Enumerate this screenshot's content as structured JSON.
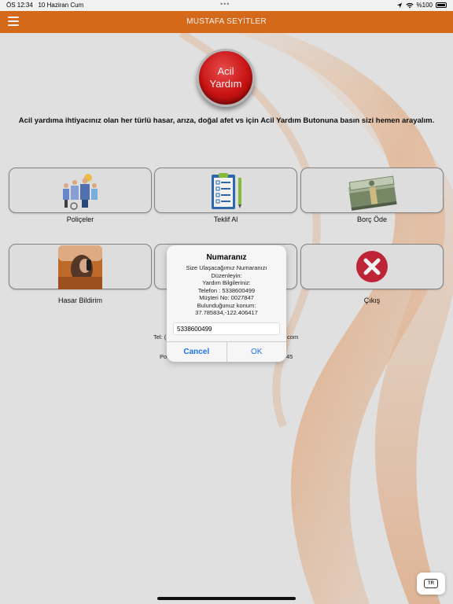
{
  "status_bar": {
    "time": "ÖS 12:34",
    "date": "10 Haziran Cum",
    "battery": "%100"
  },
  "header": {
    "title": "MUSTAFA SEYİTLER"
  },
  "emergency": {
    "button_label_line1": "Acil",
    "button_label_line2": "Yardım",
    "description": "Acil yardıma ihtiyacınız olan her türlü hasar, arıza, doğal afet vs için Acil Yardım Butonuna basın sizi hemen arayalım."
  },
  "tiles": [
    {
      "label": "Poliçeler",
      "icon": "family-icon"
    },
    {
      "label": "Teklif Al",
      "icon": "clipboard-icon"
    },
    {
      "label": "Borç Öde",
      "icon": "money-icon"
    },
    {
      "label": "Hasar Bildirim",
      "icon": "phone-call-icon"
    },
    {
      "label": "",
      "icon": "hidden-tile-icon"
    },
    {
      "label": "Çıkış",
      "icon": "exit-icon"
    }
  ],
  "contact": {
    "tel_prefix": "Tel: (",
    "tel_suffix": "com",
    "posta_prefix": "Po",
    "posta_suffix": "45"
  },
  "alert": {
    "title": "Numaranız",
    "message_lines": [
      "Size Ulaşacağımız Numaranızı",
      "Düzenleyin:",
      "Yardım Bilgileriniz:",
      "Telefon : 5338600499",
      "Müşteri No: 0027847",
      "Bulunduğunuz konum:",
      "37.785834,-122.406417"
    ],
    "input_value": "5338600499",
    "cancel_label": "Cancel",
    "ok_label": "OK"
  },
  "language_button": {
    "label": "TR"
  },
  "colors": {
    "header_bg": "#e06f1c",
    "emergency_red": "#d41414",
    "link_blue": "#1a73e8"
  }
}
